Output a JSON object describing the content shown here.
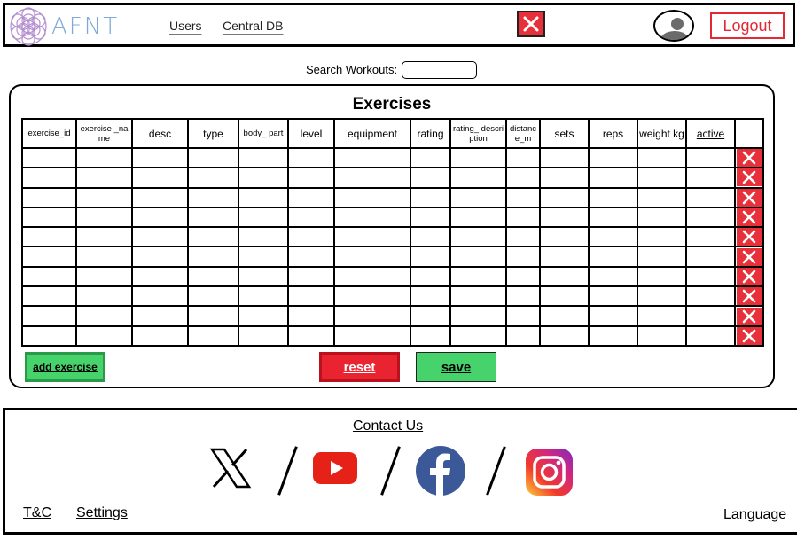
{
  "header": {
    "logo_text": "AFNT",
    "nav": {
      "users": "Users",
      "central_db": "Central DB"
    },
    "logout_label": "Logout"
  },
  "search": {
    "label": "Search Workouts:",
    "value": "",
    "placeholder": ""
  },
  "panel": {
    "title": "Exercises",
    "columns": [
      "exercise_id",
      "exercise _name",
      "desc",
      "type",
      "body_ part",
      "level",
      "equipment",
      "rating",
      "rating_ description",
      "distanc e_m",
      "sets",
      "reps",
      "weight kg",
      "active"
    ],
    "row_count": 10,
    "buttons": {
      "add": "add exercise",
      "reset": "reset",
      "save": "save"
    }
  },
  "footer": {
    "contact": "Contact Us",
    "tandc": "T&C",
    "settings": "Settings",
    "language": "Language"
  },
  "colors": {
    "accent_red": "#e8303a",
    "accent_green": "#47d36c",
    "logo_blue": "#7fa9d8",
    "logo_purple": "#b48fd0"
  }
}
